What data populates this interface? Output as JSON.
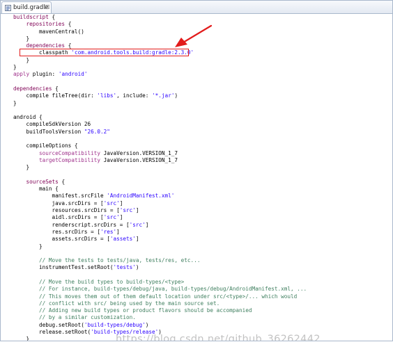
{
  "tab": {
    "label": "build.gradle",
    "close_glyph": "☒",
    "icon": "gradle-file-icon"
  },
  "code_lines": [
    [
      {
        "c": "kw",
        "t": "buildscript"
      },
      {
        "c": "",
        "t": " {"
      }
    ],
    [
      {
        "c": "",
        "t": "    "
      },
      {
        "c": "kw",
        "t": "repositories"
      },
      {
        "c": "",
        "t": " {"
      }
    ],
    [
      {
        "c": "",
        "t": "        mavenCentral()"
      }
    ],
    [
      {
        "c": "",
        "t": "    }"
      }
    ],
    [
      {
        "c": "",
        "t": "    "
      },
      {
        "c": "kw",
        "t": "dependencies"
      },
      {
        "c": "",
        "t": " {"
      }
    ],
    [
      {
        "c": "",
        "t": "        classpath "
      },
      {
        "c": "str",
        "t": "'com.android.tools.build:gradle:2.3.0'"
      }
    ],
    [
      {
        "c": "",
        "t": "    }"
      }
    ],
    [
      {
        "c": "",
        "t": "}"
      }
    ],
    [
      {
        "c": "kw2",
        "t": "apply"
      },
      {
        "c": "",
        "t": " plugin: "
      },
      {
        "c": "str",
        "t": "'android'"
      }
    ],
    [
      {
        "c": "",
        "t": ""
      }
    ],
    [
      {
        "c": "kw",
        "t": "dependencies"
      },
      {
        "c": "",
        "t": " {"
      }
    ],
    [
      {
        "c": "",
        "t": "    compile fileTree(dir: "
      },
      {
        "c": "str",
        "t": "'libs'"
      },
      {
        "c": "",
        "t": ", include: "
      },
      {
        "c": "str",
        "t": "'*.jar'"
      },
      {
        "c": "",
        "t": ")"
      }
    ],
    [
      {
        "c": "",
        "t": "}"
      }
    ],
    [
      {
        "c": "",
        "t": ""
      }
    ],
    [
      {
        "c": "",
        "t": "android {"
      }
    ],
    [
      {
        "c": "",
        "t": "    compileSdkVersion 26"
      }
    ],
    [
      {
        "c": "",
        "t": "    buildToolsVersion "
      },
      {
        "c": "str",
        "t": "\"26.0.2\""
      }
    ],
    [
      {
        "c": "",
        "t": ""
      }
    ],
    [
      {
        "c": "",
        "t": "    compileOptions {"
      }
    ],
    [
      {
        "c": "",
        "t": "        "
      },
      {
        "c": "kw2",
        "t": "sourceCompatibility"
      },
      {
        "c": "",
        "t": " JavaVersion.VERSION_1_7"
      }
    ],
    [
      {
        "c": "",
        "t": "        "
      },
      {
        "c": "kw2",
        "t": "targetCompatibility"
      },
      {
        "c": "",
        "t": " JavaVersion.VERSION_1_7"
      }
    ],
    [
      {
        "c": "",
        "t": "    }"
      }
    ],
    [
      {
        "c": "",
        "t": ""
      }
    ],
    [
      {
        "c": "",
        "t": "    "
      },
      {
        "c": "kw",
        "t": "sourceSets"
      },
      {
        "c": "",
        "t": " {"
      }
    ],
    [
      {
        "c": "",
        "t": "        main {"
      }
    ],
    [
      {
        "c": "",
        "t": "            manifest.srcFile "
      },
      {
        "c": "str",
        "t": "'AndroidManifest.xml'"
      }
    ],
    [
      {
        "c": "",
        "t": "            java.srcDirs = ["
      },
      {
        "c": "str",
        "t": "'src'"
      },
      {
        "c": "",
        "t": "]"
      }
    ],
    [
      {
        "c": "",
        "t": "            resources.srcDirs = ["
      },
      {
        "c": "str",
        "t": "'src'"
      },
      {
        "c": "",
        "t": "]"
      }
    ],
    [
      {
        "c": "",
        "t": "            aidl.srcDirs = ["
      },
      {
        "c": "str",
        "t": "'src'"
      },
      {
        "c": "",
        "t": "]"
      }
    ],
    [
      {
        "c": "",
        "t": "            renderscript.srcDirs = ["
      },
      {
        "c": "str",
        "t": "'src'"
      },
      {
        "c": "",
        "t": "]"
      }
    ],
    [
      {
        "c": "",
        "t": "            res.srcDirs = ["
      },
      {
        "c": "str",
        "t": "'res'"
      },
      {
        "c": "",
        "t": "]"
      }
    ],
    [
      {
        "c": "",
        "t": "            assets.srcDirs = ["
      },
      {
        "c": "str",
        "t": "'assets'"
      },
      {
        "c": "",
        "t": "]"
      }
    ],
    [
      {
        "c": "",
        "t": "        }"
      }
    ],
    [
      {
        "c": "",
        "t": ""
      }
    ],
    [
      {
        "c": "",
        "t": "        "
      },
      {
        "c": "cm",
        "t": "// Move the tests to tests/java, tests/res, etc..."
      }
    ],
    [
      {
        "c": "",
        "t": "        instrumentTest.setRoot("
      },
      {
        "c": "str",
        "t": "'tests'"
      },
      {
        "c": "",
        "t": ")"
      }
    ],
    [
      {
        "c": "",
        "t": ""
      }
    ],
    [
      {
        "c": "",
        "t": "        "
      },
      {
        "c": "cm",
        "t": "// Move the build types to build-types/<type>"
      }
    ],
    [
      {
        "c": "",
        "t": "        "
      },
      {
        "c": "cm",
        "t": "// For instance, build-types/debug/java, build-types/debug/AndroidManifest.xml, ..."
      }
    ],
    [
      {
        "c": "",
        "t": "        "
      },
      {
        "c": "cm",
        "t": "// This moves them out of them default location under src/<type>/... which would"
      }
    ],
    [
      {
        "c": "",
        "t": "        "
      },
      {
        "c": "cm",
        "t": "// conflict with src/ being used by the main source set."
      }
    ],
    [
      {
        "c": "",
        "t": "        "
      },
      {
        "c": "cm",
        "t": "// Adding new build types or product flavors should be accompanied"
      }
    ],
    [
      {
        "c": "",
        "t": "        "
      },
      {
        "c": "cm",
        "t": "// by a similar customization."
      }
    ],
    [
      {
        "c": "",
        "t": "        debug.setRoot("
      },
      {
        "c": "str",
        "t": "'build-types/debug'"
      },
      {
        "c": "",
        "t": ")"
      }
    ],
    [
      {
        "c": "",
        "t": "        release.setRoot("
      },
      {
        "c": "str",
        "t": "'build-types/release'"
      },
      {
        "c": "",
        "t": ")"
      }
    ],
    [
      {
        "c": "",
        "t": "    }"
      }
    ],
    [
      {
        "c": "",
        "t": "}"
      }
    ]
  ],
  "watermark": "https://blog.csdn.net/github_36262442",
  "colors": {
    "keyword": "#7f0055",
    "string": "#2a00ff",
    "comment": "#3f7f5f",
    "annotation": "#e21b1b"
  }
}
